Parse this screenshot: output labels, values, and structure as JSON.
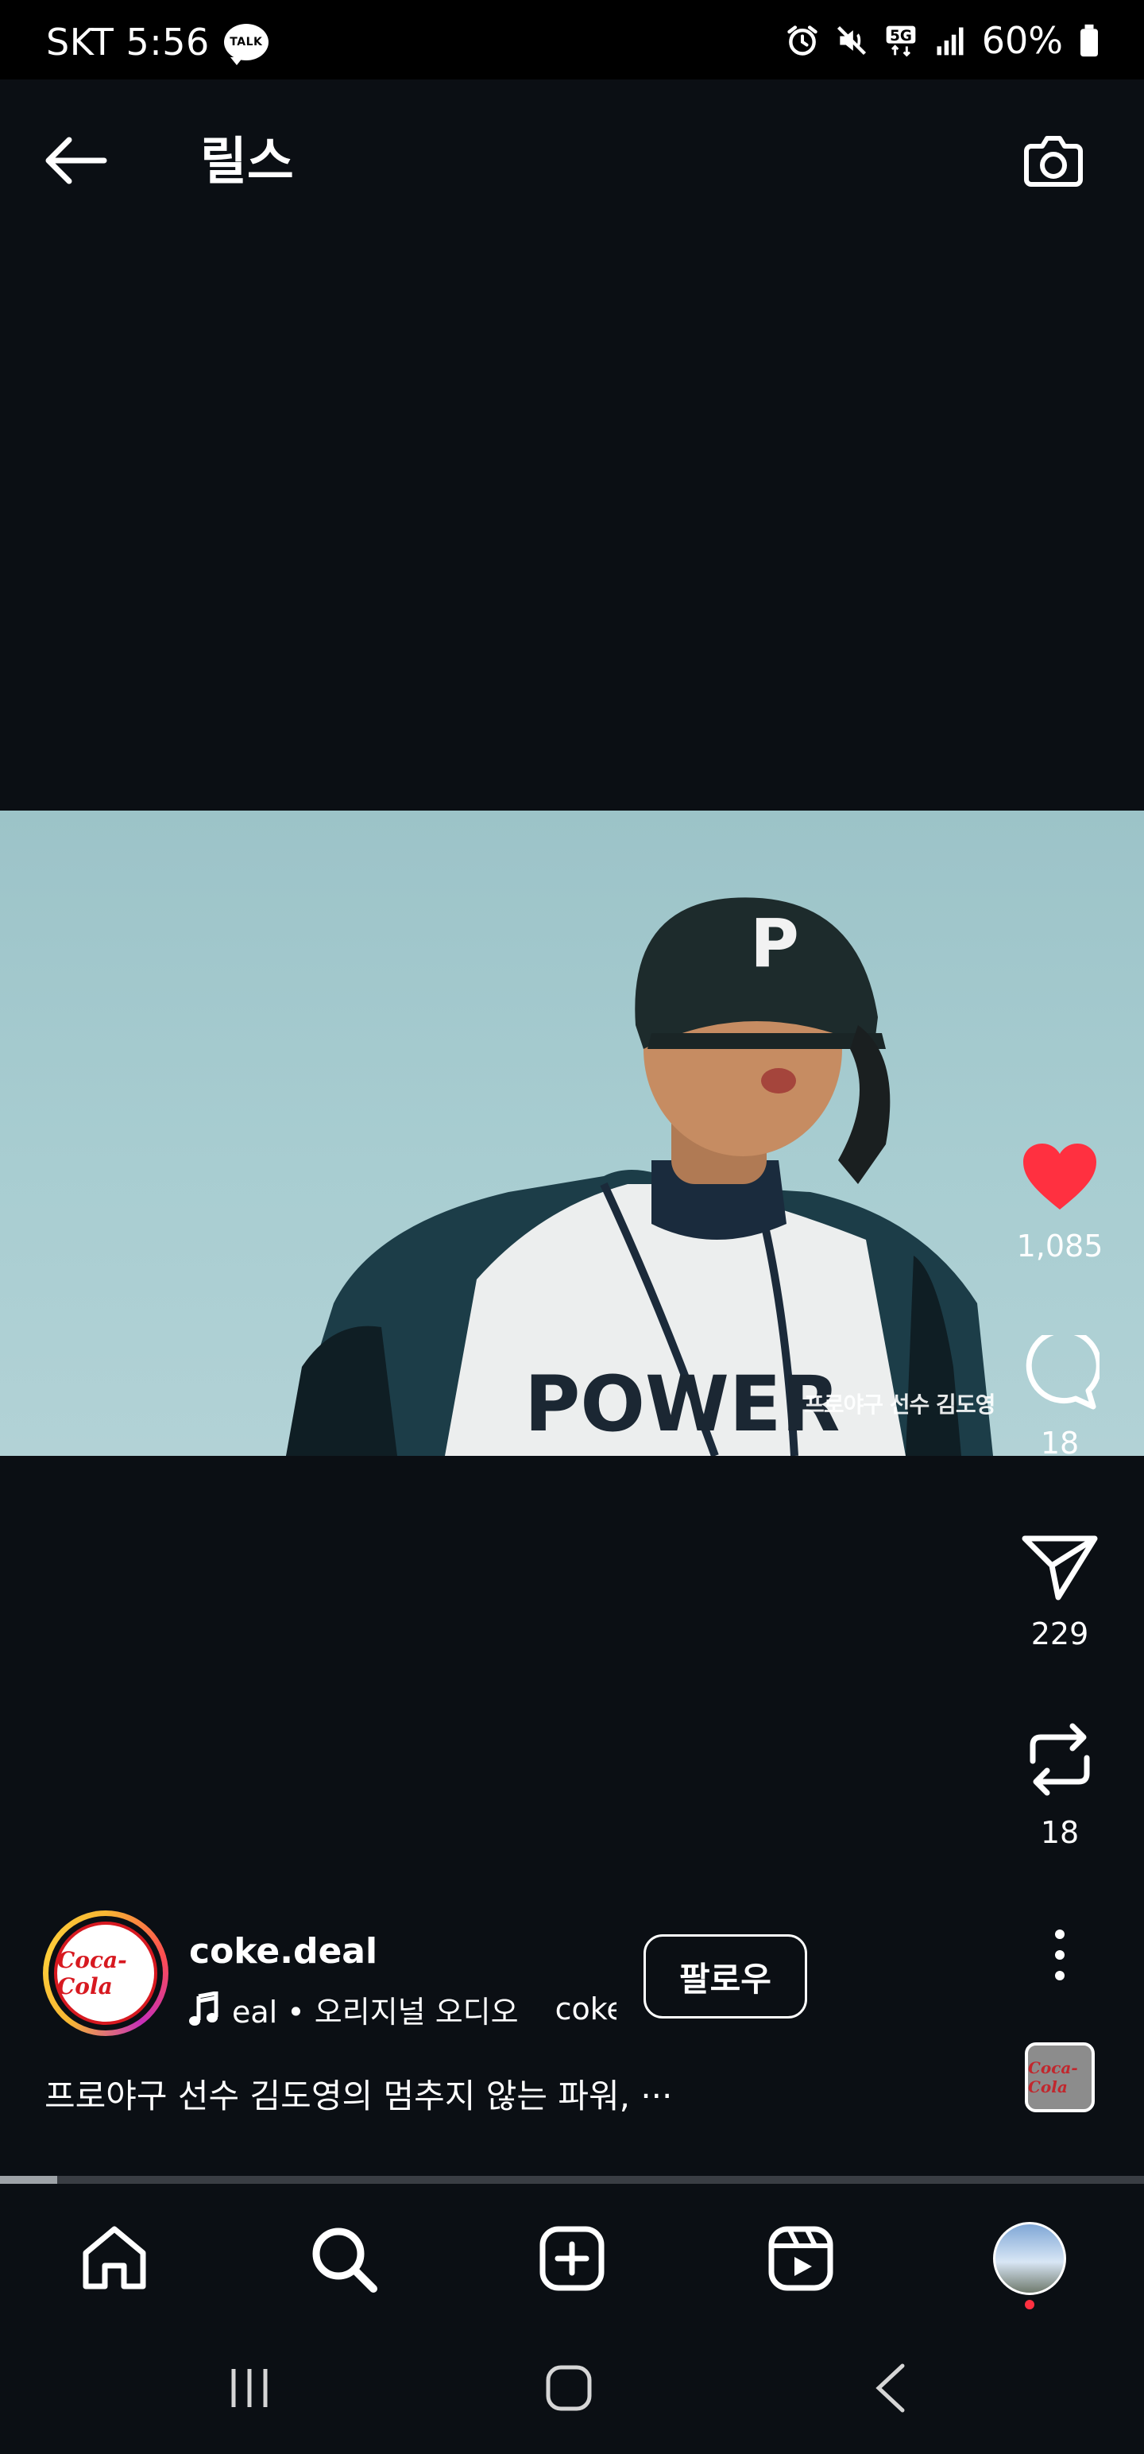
{
  "status_bar": {
    "carrier_time": "SKT 5:56",
    "talk_badge": "TALK",
    "network": "5G",
    "battery": "60%",
    "icons": [
      "alarm-icon",
      "mute-icon",
      "5g-icon",
      "signal-icon",
      "battery-icon"
    ]
  },
  "header": {
    "title": "릴스",
    "back_icon": "back-arrow-icon",
    "camera_icon": "camera-icon"
  },
  "video": {
    "overlay_caption": "프로야구 선수 김도영",
    "jersey_letter": "P",
    "jersey_text": "POWER"
  },
  "actions": {
    "likes": "1,085",
    "comments": "18",
    "shares": "229",
    "reposts": "18",
    "like_color": "#ff3040"
  },
  "author": {
    "username": "coke.deal",
    "avatar_text": "Coca-Cola",
    "audio_text": "eal • 오리지널 오디오",
    "audio_text_2": "coke.de",
    "follow_label": "팔로우",
    "caption": "프로야구 선수 김도영의 멈추지 않는 파워, ···",
    "audio_thumb_text": "Coca-Cola"
  },
  "progress": {
    "value": 0.05
  },
  "bottom_nav": {
    "items": [
      "home-icon",
      "search-icon",
      "create-icon",
      "reels-icon",
      "profile-avatar"
    ]
  }
}
